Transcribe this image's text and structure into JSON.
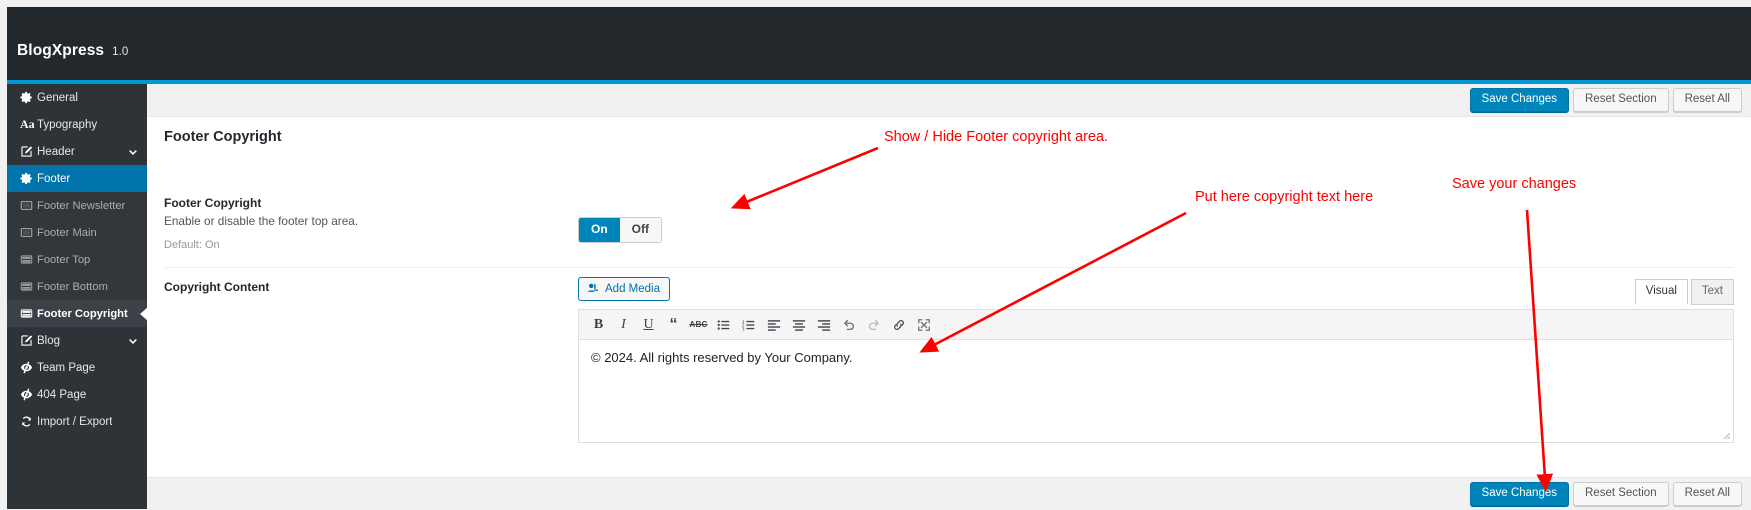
{
  "topbar": {
    "brand": "BlogXpress",
    "version": "1.0"
  },
  "sidebar": {
    "items": [
      {
        "label": "General",
        "icon": "gear-icon",
        "level": 1,
        "state": "normal",
        "chevron": false
      },
      {
        "label": "Typography",
        "icon": "typography-icon",
        "level": 1,
        "state": "normal",
        "chevron": false
      },
      {
        "label": "Header",
        "icon": "pencil-square-icon",
        "level": 1,
        "state": "normal",
        "chevron": true
      },
      {
        "label": "Footer",
        "icon": "gear-icon",
        "level": 1,
        "state": "active",
        "chevron": false
      },
      {
        "label": "Footer Newsletter",
        "icon": "window-icon",
        "level": 2,
        "state": "normal",
        "chevron": false
      },
      {
        "label": "Footer Main",
        "icon": "window-icon",
        "level": 2,
        "state": "normal",
        "chevron": false
      },
      {
        "label": "Footer Top",
        "icon": "layout-top-icon",
        "level": 2,
        "state": "normal",
        "chevron": false
      },
      {
        "label": "Footer Bottom",
        "icon": "layout-top-icon",
        "level": 2,
        "state": "normal",
        "chevron": false
      },
      {
        "label": "Footer Copyright",
        "icon": "layout-top-icon",
        "level": 2,
        "state": "current",
        "chevron": false
      },
      {
        "label": "Blog",
        "icon": "pencil-square-icon",
        "level": 1,
        "state": "normal",
        "chevron": true
      },
      {
        "label": "Team Page",
        "icon": "eye-slash-icon",
        "level": 1,
        "state": "normal",
        "chevron": false
      },
      {
        "label": "404 Page",
        "icon": "eye-slash-icon",
        "level": 1,
        "state": "normal",
        "chevron": false
      },
      {
        "label": "Import / Export",
        "icon": "refresh-icon",
        "level": 1,
        "state": "normal",
        "chevron": false
      }
    ]
  },
  "actions": {
    "save_changes": "Save Changes",
    "reset_section": "Reset Section",
    "reset_all": "Reset All"
  },
  "content": {
    "section_title": "Footer Copyright",
    "toggle_field": {
      "label": "Footer Copyright",
      "description": "Enable or disable the footer top area.",
      "default_text": "Default: On",
      "on_label": "On",
      "off_label": "Off",
      "selected": "On"
    },
    "editor_field": {
      "label": "Copyright Content",
      "add_media_label": "Add Media",
      "add_media_icon": "media-icon",
      "tabs": [
        {
          "label": "Visual",
          "active": true
        },
        {
          "label": "Text",
          "active": false
        }
      ],
      "toolbar": [
        {
          "icon": "bold-icon",
          "glyph": "B"
        },
        {
          "icon": "italic-icon",
          "glyph": "I"
        },
        {
          "icon": "underline-icon",
          "glyph": "U"
        },
        {
          "icon": "blockquote-icon",
          "glyph": "“"
        },
        {
          "icon": "strikethrough-icon",
          "glyph": "ABC"
        },
        {
          "icon": "bulleted-list-icon",
          "glyph": "☰"
        },
        {
          "icon": "numbered-list-icon",
          "glyph": "☰"
        },
        {
          "icon": "align-left-icon",
          "glyph": "≡"
        },
        {
          "icon": "align-center-icon",
          "glyph": "≡"
        },
        {
          "icon": "align-right-icon",
          "glyph": "≡"
        },
        {
          "icon": "undo-icon",
          "glyph": "↶"
        },
        {
          "icon": "redo-icon",
          "glyph": "↷"
        },
        {
          "icon": "link-icon",
          "glyph": "🔗"
        },
        {
          "icon": "fullscreen-icon",
          "glyph": "⛶"
        }
      ],
      "body_text": "© 2024. All rights reserved by Your Company."
    }
  },
  "annotations": [
    {
      "text": "Show / Hide Footer copyright area.",
      "color": "#ff0000"
    },
    {
      "text": "Put here copyright text here",
      "color": "#ff0000"
    },
    {
      "text": "Save your changes",
      "color": "#ff0000"
    }
  ],
  "colors": {
    "accent": "#0099d5",
    "topbar_bg": "#23282d",
    "sidebar_bg": "#2d3337",
    "sidebar_active": "#0073aa",
    "primary_button": "#0085ba",
    "annotation": "#ff0000"
  }
}
